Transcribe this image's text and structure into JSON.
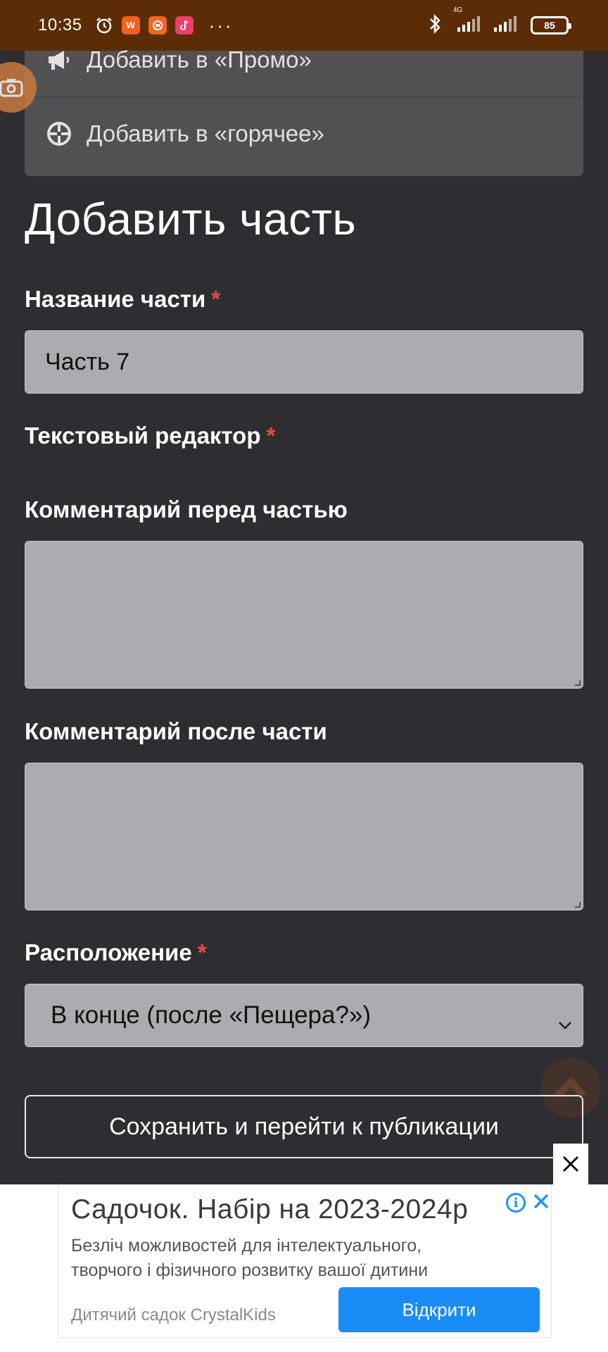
{
  "status_bar": {
    "time": "10:35",
    "network": "4G",
    "battery": "85",
    "more": "···"
  },
  "menu": {
    "items": [
      {
        "label": "Добавить в «Промо»",
        "icon": "megaphone-icon"
      },
      {
        "label": "Добавить в «горячее»",
        "icon": "crosshair-icon"
      }
    ]
  },
  "form": {
    "title": "Добавить часть",
    "part_name_label": "Название части",
    "part_name_value": "Часть 7",
    "text_editor_label": "Текстовый редактор",
    "comment_before_label": "Комментарий перед частью",
    "comment_before_value": "",
    "comment_after_label": "Комментарий после части",
    "comment_after_value": "",
    "position_label": "Расположение",
    "position_value": "В конце (после «Пещера?»)",
    "required_mark": "*",
    "save_button": "Сохранить и перейти к публикации"
  },
  "ad": {
    "title": "Садочок. Набір на 2023-2024р",
    "description": "Безліч можливостей для інтелектуального, творчого і фізичного розвитку вашої дитини",
    "advertiser": "Дитячий садок CrystalKids",
    "cta": "Відкрити",
    "info_glyph": "i"
  },
  "colors": {
    "status_bar_bg": "#5b2c05",
    "page_bg": "#2e2d31",
    "input_bg": "#acabb0",
    "required": "#e74c3c",
    "ad_cta": "#1a8cf5"
  }
}
